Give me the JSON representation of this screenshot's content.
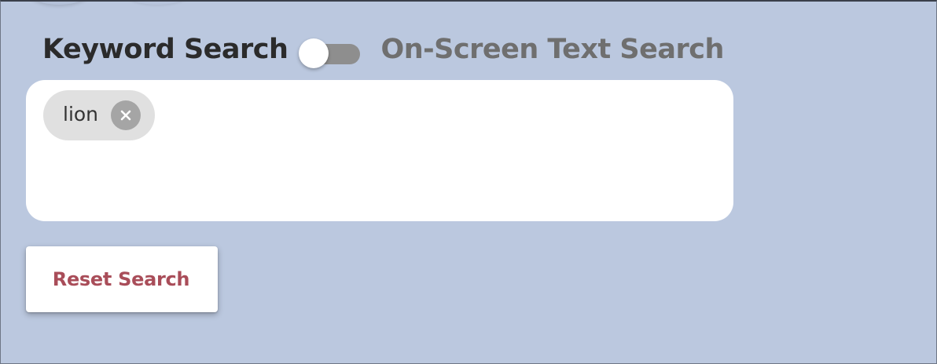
{
  "search_mode": {
    "keyword_label": "Keyword Search",
    "onscreen_label": "On-Screen Text Search",
    "toggle_state": "off"
  },
  "search_box": {
    "chips": [
      {
        "label": "lion",
        "remove_icon": "close-circle-icon"
      }
    ]
  },
  "actions": {
    "reset_label": "Reset Search"
  },
  "colors": {
    "background": "#bbc8df",
    "active_text": "#2b2b2b",
    "inactive_text": "#6f6f6f",
    "toggle_track": "#8e8e8e",
    "chip_background": "#e0e0e0",
    "chip_remove": "#a5a5a5",
    "reset_text": "#a94d59"
  }
}
